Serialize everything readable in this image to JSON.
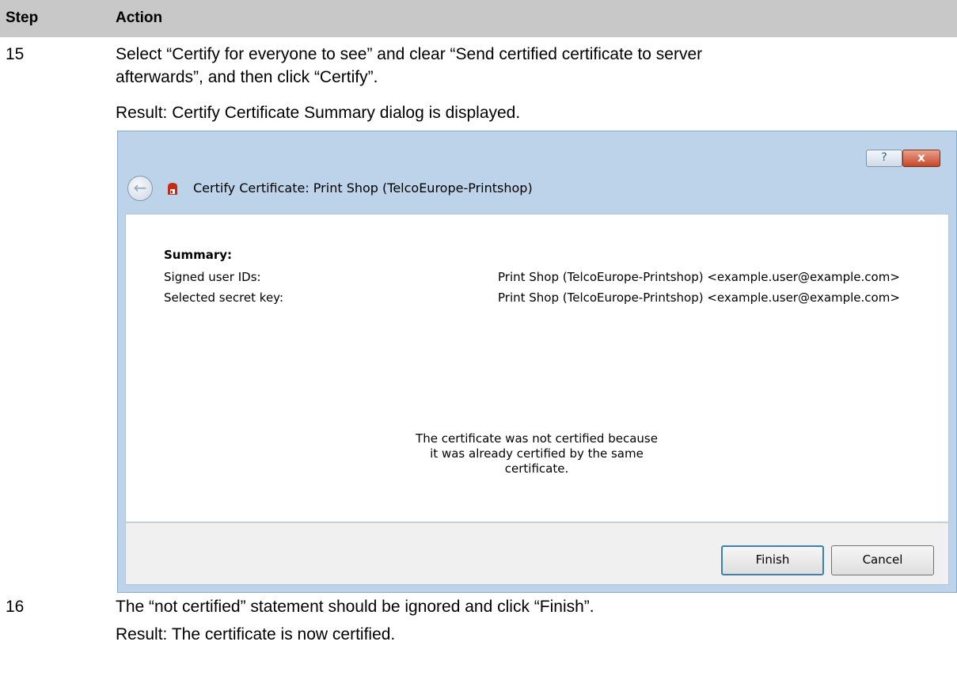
{
  "table": {
    "header": {
      "step": "Step",
      "action": "Action"
    },
    "rows": [
      {
        "step": "15",
        "action_line1": "Select “Certify for everyone to see” and clear “Send certified certificate to server",
        "action_line2": "afterwards”, and then click “Certify”.",
        "result": "Result: Certify Certificate Summary dialog is displayed."
      },
      {
        "step": "16",
        "action": "The “not certified” statement should be ignored and click “Finish”.",
        "result": "Result: The certificate is now certified."
      }
    ]
  },
  "dialog": {
    "title": "Certify Certificate: Print Shop (TelcoEurope-Printshop)",
    "help_label": "?",
    "close_label": "x",
    "summary": {
      "heading": "Summary:",
      "signed_ids_label": "Signed user IDs:",
      "signed_ids_value": "Print Shop (TelcoEurope-Printshop) <example.user@example.com>",
      "secret_key_label": "Selected secret key:",
      "secret_key_value": "Print Shop (TelcoEurope-Printshop) <example.user@example.com>"
    },
    "notice": "The certificate was not certified because\nit was already certified by the same\ncertificate.",
    "finish_label": "Finish",
    "cancel_label": "Cancel"
  },
  "colors": {
    "header_bg": "#c8c8c8",
    "dialog_frame": "#bcd3ea",
    "close_button": "#c6482a",
    "icon_red": "#c62a12"
  },
  "icons": {
    "back": "back-arrow-icon",
    "app": "certificate-app-icon",
    "help": "help-icon",
    "close": "close-icon"
  }
}
